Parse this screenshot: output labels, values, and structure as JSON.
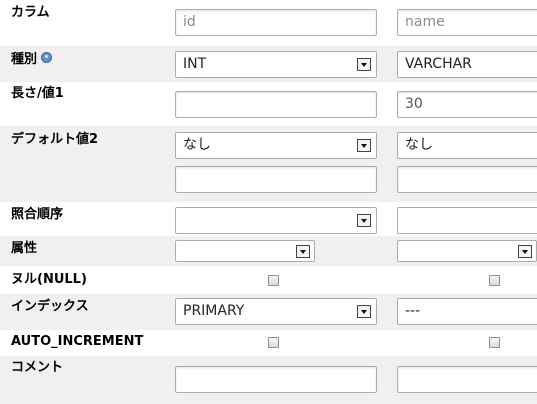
{
  "rows": {
    "column": {
      "label": "カラム",
      "col1_placeholder": "id",
      "col2_placeholder": "name"
    },
    "type": {
      "label": "種別",
      "help_icon": "help-icon",
      "col1_value": "INT",
      "col2_value": "VARCHAR"
    },
    "length": {
      "label": "長さ/値1",
      "col1_value": "",
      "col2_value": "30"
    },
    "default": {
      "label": "デフォルト値2",
      "col1_value": "なし",
      "col2_value": "なし"
    },
    "collation": {
      "label": "照合順序",
      "col1_value": "",
      "col2_value": ""
    },
    "attributes": {
      "label": "属性",
      "col1_value": "",
      "col2_value": ""
    },
    "null": {
      "label": "ヌル(NULL)"
    },
    "index": {
      "label": "インデックス",
      "col1_value": "PRIMARY",
      "col2_value": "---"
    },
    "auto_increment": {
      "label": "AUTO_INCREMENT"
    },
    "comment": {
      "label": "コメント"
    }
  }
}
